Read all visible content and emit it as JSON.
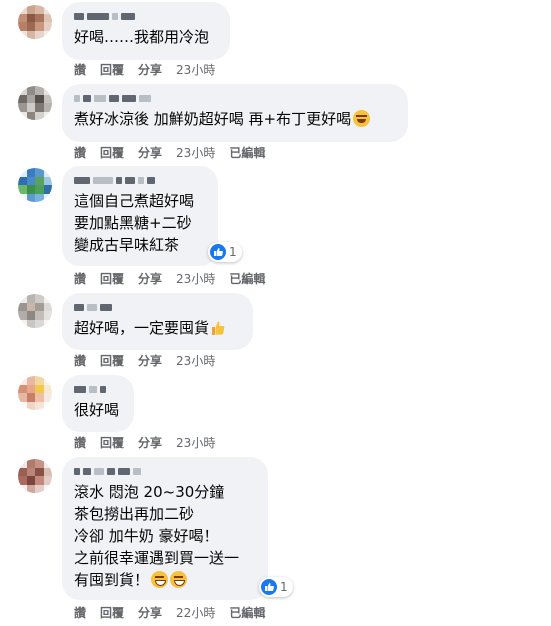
{
  "labels": {
    "like": "讚",
    "reply": "回覆",
    "share": "分享",
    "edited": "已編輯"
  },
  "comments": [
    {
      "lines": [
        "好喝……我都用冷泡"
      ],
      "time": "23小時"
    },
    {
      "lines": [
        "煮好冰涼後 加鮮奶超好喝 再+布丁更好喝"
      ],
      "time": "23小時"
    },
    {
      "lines": [
        "這個自己煮超好喝",
        "要加點黑糖+二砂",
        "變成古早味紅茶"
      ],
      "time": "23小時",
      "reaction_count": "1"
    },
    {
      "lines": [
        "超好喝，一定要囤貨"
      ],
      "time": "23小時"
    },
    {
      "lines": [
        "很好喝"
      ],
      "time": "23小時"
    },
    {
      "lines": [
        "滾水 悶泡 20~30分鐘",
        "茶包撈出再加二砂",
        "冷卻 加牛奶 豪好喝！",
        "之前很幸運遇到買一送一",
        "有囤到貨！"
      ],
      "time": "22小時",
      "reaction_count": "1"
    }
  ],
  "colors": {
    "bubble": "#f0f2f5",
    "meta_text": "#65676b",
    "like_blue": "#1877f2"
  }
}
